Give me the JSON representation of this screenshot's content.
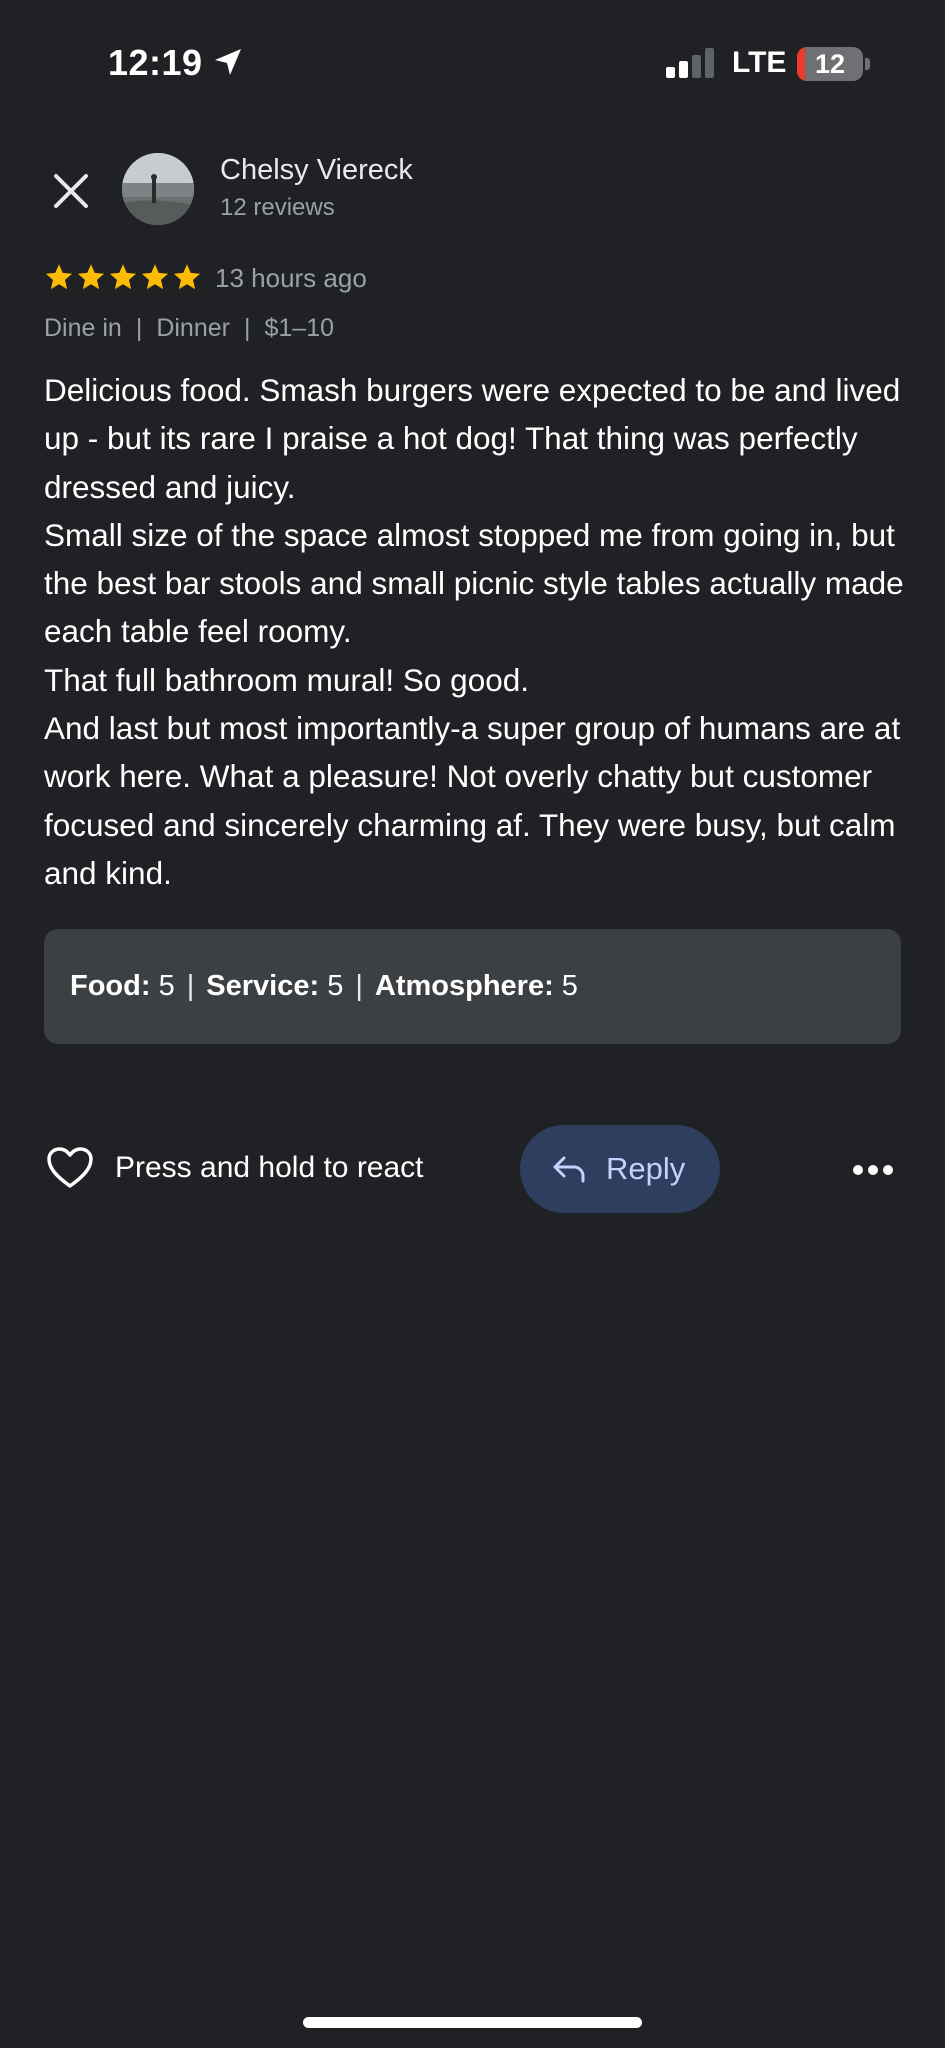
{
  "status_bar": {
    "time": "12:19",
    "network": "LTE",
    "battery_level": "12",
    "battery_fraction": 0.12,
    "battery_color": "#eb3b2f"
  },
  "reviewer": {
    "name": "Chelsy Viereck",
    "review_count": "12 reviews"
  },
  "review": {
    "rating": 5,
    "star_color": "#fbbc04",
    "time": "13 hours ago",
    "meta": [
      "Dine in",
      "Dinner",
      "$1–10"
    ],
    "meta_separator": "|",
    "paragraphs": [
      "Delicious food. Smash burgers were expected to be and lived up - but its rare I praise a hot dog! That thing was perfectly dressed and juicy.",
      "Small size of the space almost stopped me from going in, but the best bar stools and small picnic style tables actually made each table feel roomy.",
      "That full bathroom mural! So good.",
      "And last but most importantly-a super group of humans are at work here. What a pleasure! Not overly chatty but customer focused and sincerely charming af. They were busy, but calm and kind."
    ],
    "sub_ratings": [
      {
        "label": "Food:",
        "value": "5"
      },
      {
        "label": "Service:",
        "value": "5"
      },
      {
        "label": "Atmosphere:",
        "value": "5"
      }
    ],
    "sub_rating_separator": "|"
  },
  "actions": {
    "react_label": "Press and hold to react",
    "reply_label": "Reply",
    "reply_bg": "#2e3e5e"
  },
  "icons": {
    "close": "close-icon",
    "heart": "heart-icon",
    "reply": "reply-arrow-icon",
    "more": "more-horizontal-icon",
    "location": "location-arrow-icon",
    "signal": "signal-bars-icon"
  }
}
